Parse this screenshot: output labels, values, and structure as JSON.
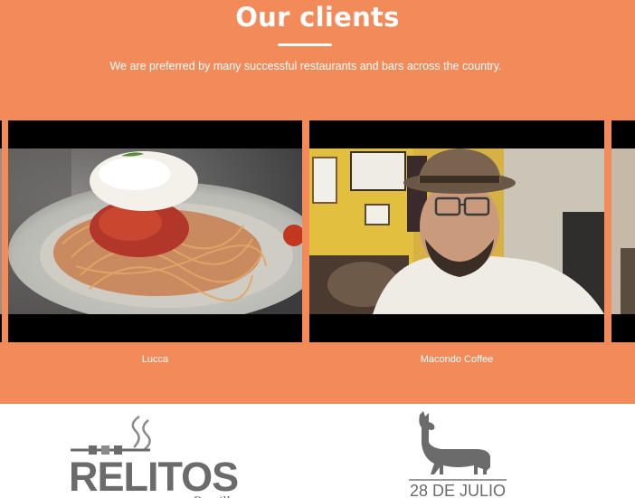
{
  "clients_section": {
    "title": "Our clients",
    "subtitle": "We are preferred by many successful restaurants and bars across the country.",
    "background_color": "#F28A5A"
  },
  "carousel": {
    "slides": [
      {
        "caption": "Lucca"
      },
      {
        "caption": "Macondo Coffee"
      }
    ]
  },
  "logos": [
    {
      "name": "RELITOS",
      "sub": "Parrilla",
      "icon": "grill-skewer-icon"
    },
    {
      "name": "28 DE JULIO",
      "icon": "llama-icon"
    }
  ]
}
